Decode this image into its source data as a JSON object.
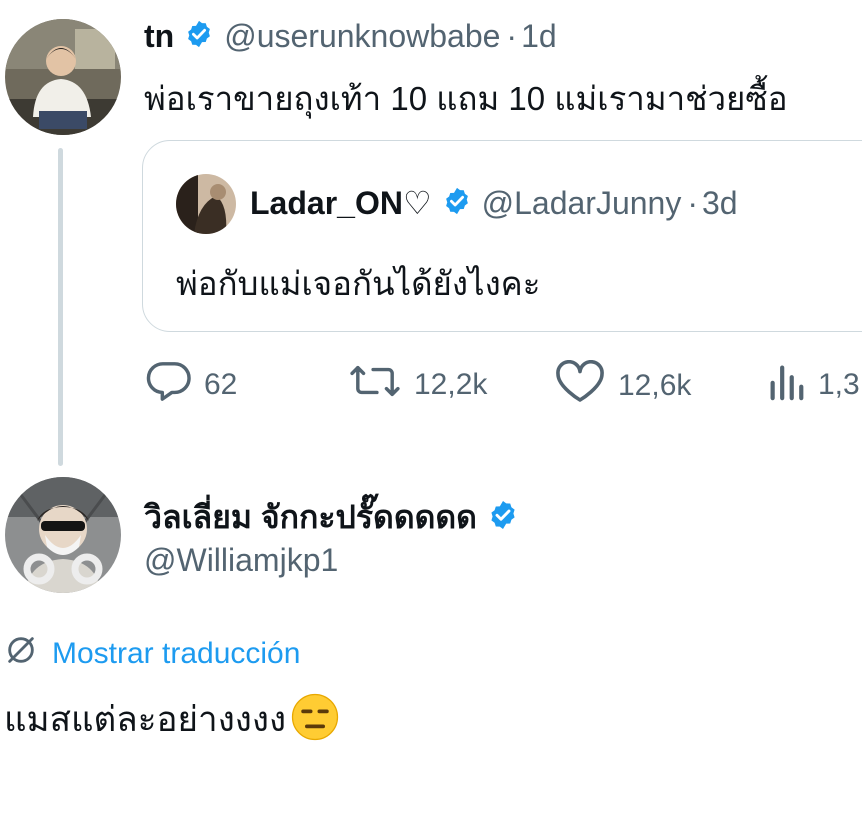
{
  "tweet": {
    "author_name": "tn",
    "handle": "@userunknowbabe",
    "separator": "·",
    "time": "1d",
    "text": "พ่อเราขายถุงเท้า 10 แถม 10  แม่เรามาช่วยซื้อ"
  },
  "quote": {
    "author_name": "Ladar_ON♡",
    "handle": "@LadarJunny",
    "separator": "·",
    "time": "3d",
    "text": "พ่อกับแม่เจอกันได้ยังไงคะ"
  },
  "actions": {
    "replies": "62",
    "retweets": "12,2k",
    "likes": "12,6k",
    "views": "1,3"
  },
  "reply": {
    "author_name": "วิลเลี่ยม จักกะปรั๊ดดดดด",
    "handle": "@Williamjkp1",
    "translate_label": "Mostrar traducción",
    "text": "แมสแต่ละอย่างงงง"
  },
  "colors": {
    "accent": "#1d9bf0",
    "text": "#0f1419",
    "muted": "#536471",
    "border": "#cfd9de"
  }
}
